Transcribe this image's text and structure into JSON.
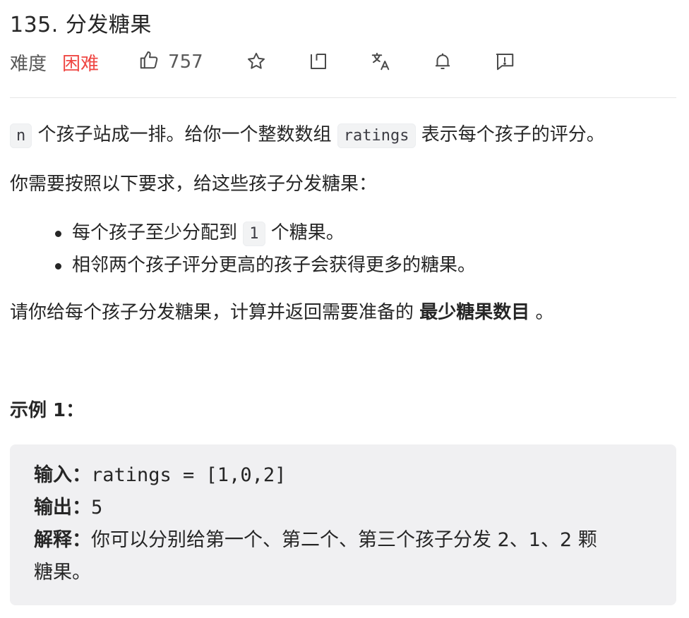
{
  "problem": {
    "title": "135. 分发糖果",
    "difficulty_label": "难度",
    "difficulty_value": "困难",
    "likes": "757"
  },
  "icons": [
    "thumbs-up-icon",
    "star-icon",
    "share-icon",
    "translate-icon",
    "bell-icon",
    "feedback-icon"
  ],
  "colors": {
    "difficulty_hard": "#ef4743",
    "code_bg": "#f2f3f4",
    "example_bg": "#f0f0f2"
  },
  "description": {
    "p1": {
      "code_n": "n",
      "text_a": " 个孩子站成一排。给你一个整数数组 ",
      "code_ratings": "ratings",
      "text_b": " 表示每个孩子的评分。"
    },
    "p2": "你需要按照以下要求，给这些孩子分发糖果：",
    "bullets": [
      {
        "text_a": "每个孩子至少分配到 ",
        "code": "1",
        "text_b": " 个糖果。"
      },
      {
        "text": "相邻两个孩子评分更高的孩子会获得更多的糖果。"
      }
    ],
    "p3": {
      "text_a": "请你给每个孩子分发糖果，计算并返回需要准备的 ",
      "bold": "最少糖果数目",
      "text_b": " 。"
    }
  },
  "example": {
    "title": "示例 1：",
    "input_label": "输入：",
    "input_value": "ratings = [1,0,2]",
    "output_label": "输出：",
    "output_value": "5",
    "explain_label": "解释：",
    "explain_text_line1": "你可以分别给第一个、第二个、第三个孩子分发 2、1、2 颗",
    "explain_text_line2": "糖果。"
  }
}
